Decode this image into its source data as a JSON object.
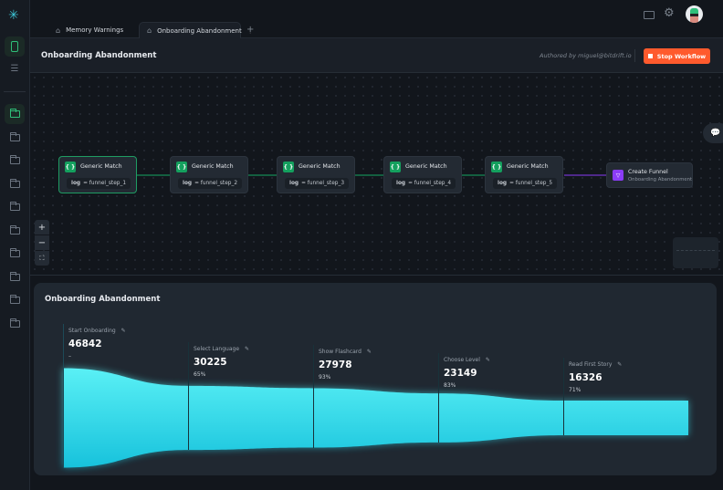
{
  "sidebar": {
    "logo": "snowflake-logo",
    "items": [
      {
        "icon": "phone-icon",
        "active": true
      },
      {
        "icon": "list-icon"
      }
    ],
    "folders": [
      {
        "active": true
      },
      {},
      {},
      {},
      {},
      {},
      {},
      {},
      {},
      {}
    ]
  },
  "tabs": [
    {
      "label": "Memory Warnings",
      "active": false
    },
    {
      "label": "Onboarding Abandonment",
      "active": true
    }
  ],
  "topbar": {
    "icons": [
      "keyboard-icon",
      "gear-icon",
      "avatar"
    ]
  },
  "header": {
    "title": "Onboarding Abandonment",
    "author": "Authored by miguel@bitdrift.io",
    "stop_button": "Stop Workflow",
    "stop_color": "#ff5a2d"
  },
  "workflow": {
    "nodes": [
      {
        "title": "Generic Match",
        "key": "log",
        "value": "= funnel_step_1"
      },
      {
        "title": "Generic Match",
        "key": "log",
        "value": "= funnel_step_2"
      },
      {
        "title": "Generic Match",
        "key": "log",
        "value": "= funnel_step_3"
      },
      {
        "title": "Generic Match",
        "key": "log",
        "value": "= funnel_step_4"
      },
      {
        "title": "Generic Match",
        "key": "log",
        "value": "= funnel_step_5"
      }
    ],
    "action": {
      "title": "Create Funnel",
      "subtitle": "Onboarding Abandonment",
      "color": "#8b3cf7"
    },
    "zoom": {
      "plus": "+",
      "minus": "−",
      "fit": "⛶"
    }
  },
  "funnel": {
    "title": "Onboarding Abandonment",
    "color": "#3fe0ee",
    "steps": [
      {
        "label": "Start Onboarding",
        "value": 46842,
        "value_text": "46842",
        "pct": "–"
      },
      {
        "label": "Select Language",
        "value": 30225,
        "value_text": "30225",
        "pct": "65%"
      },
      {
        "label": "Show Flashcard",
        "value": 27978,
        "value_text": "27978",
        "pct": "93%"
      },
      {
        "label": "Choose Level",
        "value": 23149,
        "value_text": "23149",
        "pct": "83%"
      },
      {
        "label": "Read First Story",
        "value": 16326,
        "value_text": "16326",
        "pct": "71%"
      }
    ]
  }
}
